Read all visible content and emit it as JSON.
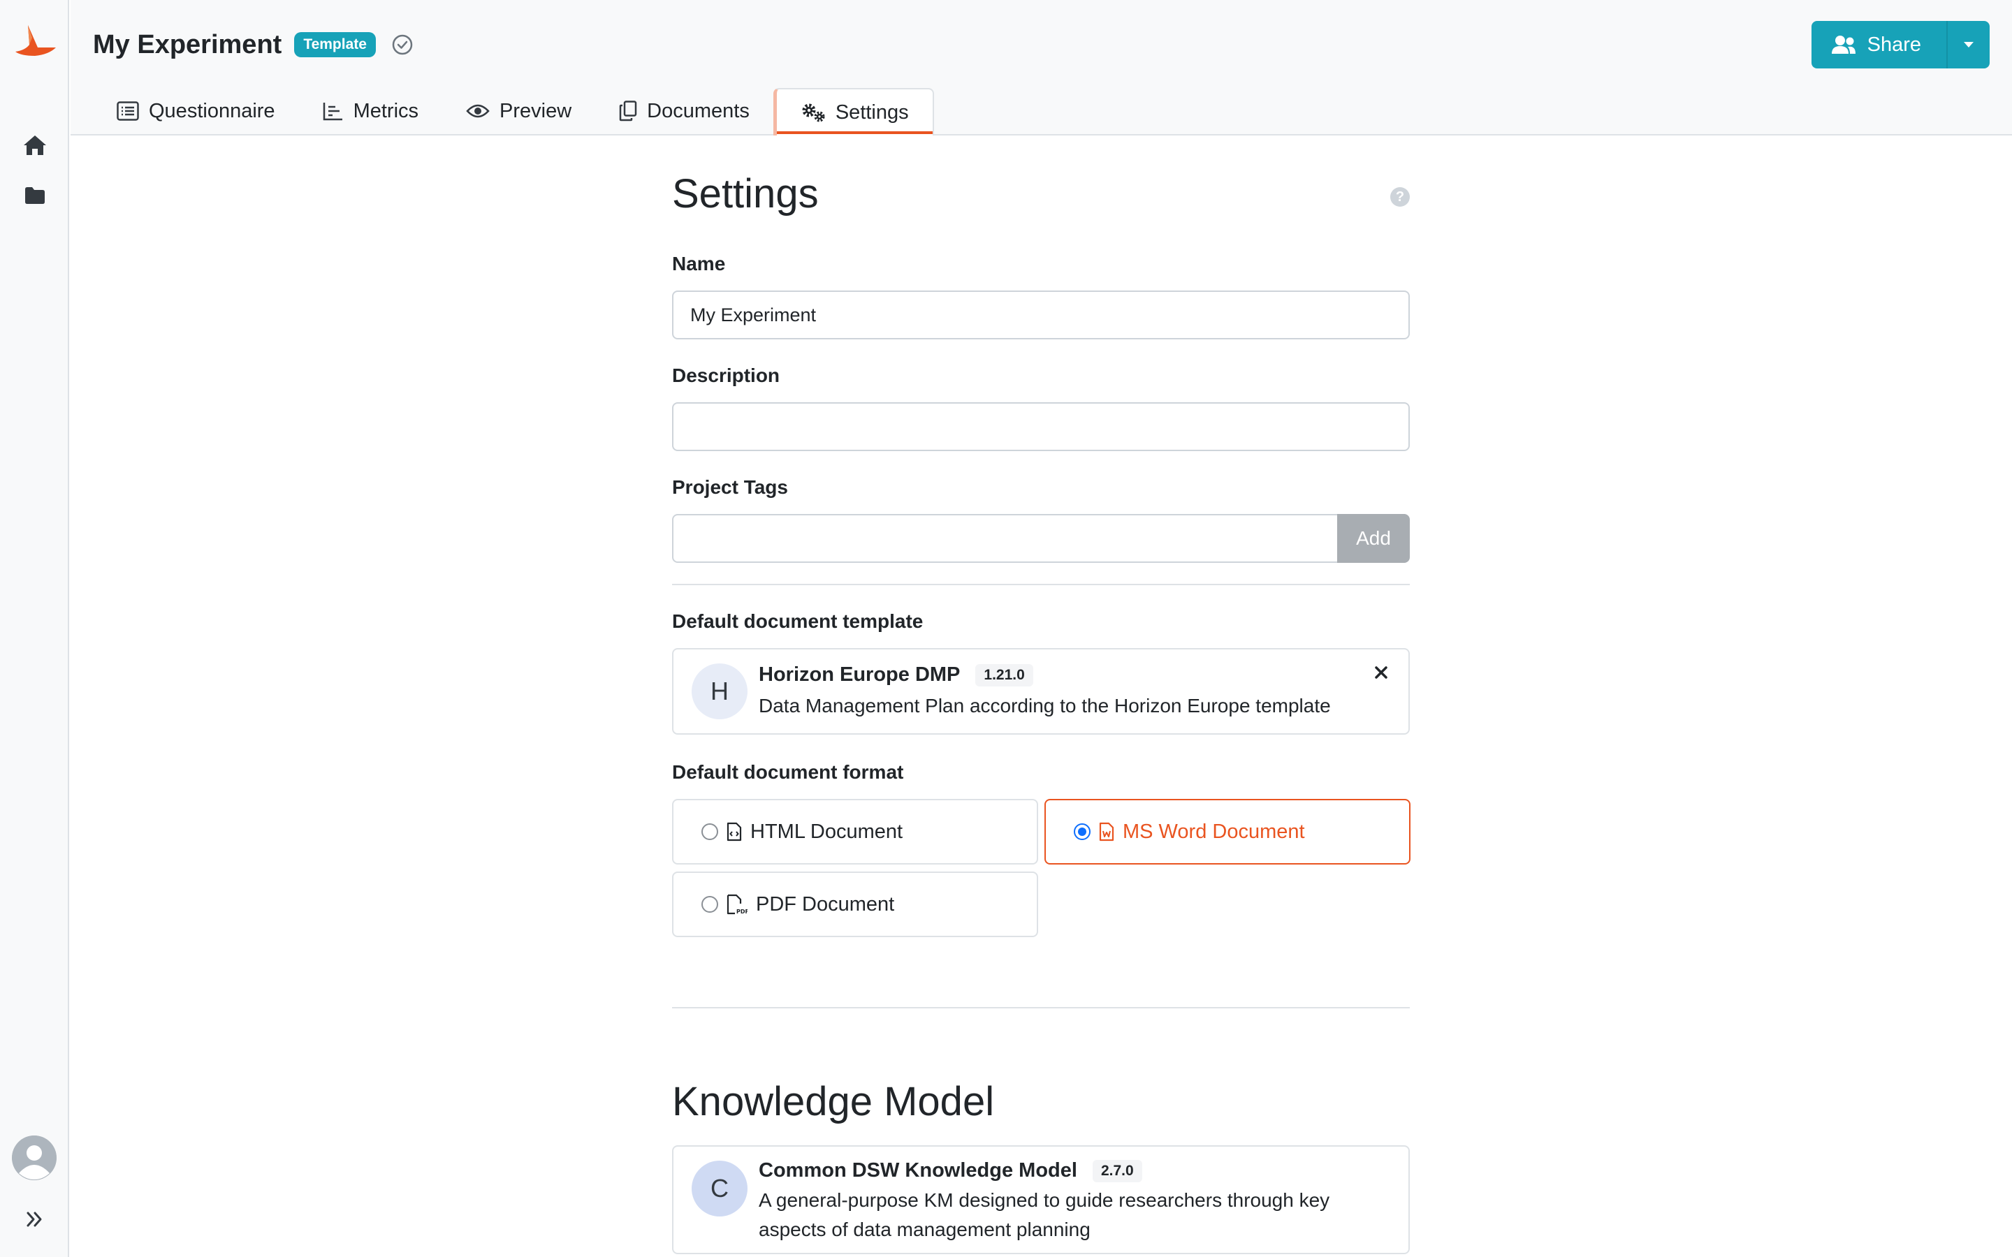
{
  "app": {
    "accent": "#e95420",
    "primary": "#17a2b8",
    "sidebar_icons": [
      "logo-icon",
      "home-icon",
      "folder-icon",
      "user-avatar-icon",
      "expand-icon"
    ]
  },
  "header": {
    "project_title": "My Experiment",
    "badge": "Template",
    "share_label": "Share",
    "tabs": [
      {
        "label": "Questionnaire",
        "icon": "list-icon"
      },
      {
        "label": "Metrics",
        "icon": "bar-chart-icon"
      },
      {
        "label": "Preview",
        "icon": "eye-icon"
      },
      {
        "label": "Documents",
        "icon": "copy-icon"
      },
      {
        "label": "Settings",
        "icon": "cogs-icon",
        "active": true
      }
    ]
  },
  "settings": {
    "title": "Settings",
    "help": "?",
    "name_label": "Name",
    "name_value": "My Experiment",
    "description_label": "Description",
    "description_value": "",
    "tags_label": "Project Tags",
    "tags_value": "",
    "add_label": "Add",
    "default_template_label": "Default document template",
    "template": {
      "initial": "H",
      "name": "Horizon Europe DMP",
      "version": "1.21.0",
      "description": "Data Management Plan according to the Horizon Europe template"
    },
    "default_format_label": "Default document format",
    "formats": [
      {
        "label": "HTML Document",
        "selected": false
      },
      {
        "label": "MS Word Document",
        "selected": true
      },
      {
        "label": "PDF Document",
        "selected": false
      }
    ]
  },
  "knowledge_model": {
    "title": "Knowledge Model",
    "initial": "C",
    "name": "Common DSW Knowledge Model",
    "version": "2.7.0",
    "description": "A general-purpose KM designed to guide researchers through key aspects of data management planning"
  }
}
